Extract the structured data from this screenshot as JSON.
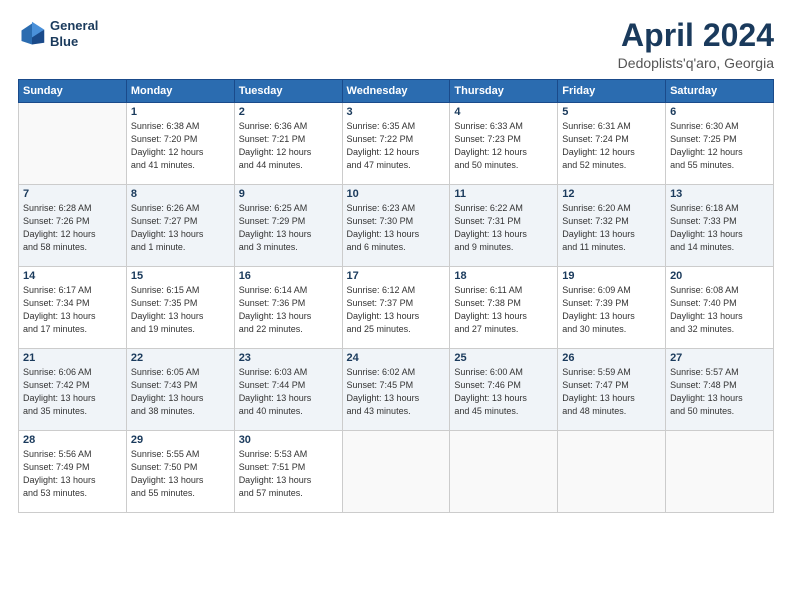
{
  "header": {
    "logo_line1": "General",
    "logo_line2": "Blue",
    "title": "April 2024",
    "location": "Dedoplists'q'aro, Georgia"
  },
  "days_of_week": [
    "Sunday",
    "Monday",
    "Tuesday",
    "Wednesday",
    "Thursday",
    "Friday",
    "Saturday"
  ],
  "weeks": [
    [
      {
        "day": "",
        "info": ""
      },
      {
        "day": "1",
        "info": "Sunrise: 6:38 AM\nSunset: 7:20 PM\nDaylight: 12 hours\nand 41 minutes."
      },
      {
        "day": "2",
        "info": "Sunrise: 6:36 AM\nSunset: 7:21 PM\nDaylight: 12 hours\nand 44 minutes."
      },
      {
        "day": "3",
        "info": "Sunrise: 6:35 AM\nSunset: 7:22 PM\nDaylight: 12 hours\nand 47 minutes."
      },
      {
        "day": "4",
        "info": "Sunrise: 6:33 AM\nSunset: 7:23 PM\nDaylight: 12 hours\nand 50 minutes."
      },
      {
        "day": "5",
        "info": "Sunrise: 6:31 AM\nSunset: 7:24 PM\nDaylight: 12 hours\nand 52 minutes."
      },
      {
        "day": "6",
        "info": "Sunrise: 6:30 AM\nSunset: 7:25 PM\nDaylight: 12 hours\nand 55 minutes."
      }
    ],
    [
      {
        "day": "7",
        "info": "Sunrise: 6:28 AM\nSunset: 7:26 PM\nDaylight: 12 hours\nand 58 minutes."
      },
      {
        "day": "8",
        "info": "Sunrise: 6:26 AM\nSunset: 7:27 PM\nDaylight: 13 hours\nand 1 minute."
      },
      {
        "day": "9",
        "info": "Sunrise: 6:25 AM\nSunset: 7:29 PM\nDaylight: 13 hours\nand 3 minutes."
      },
      {
        "day": "10",
        "info": "Sunrise: 6:23 AM\nSunset: 7:30 PM\nDaylight: 13 hours\nand 6 minutes."
      },
      {
        "day": "11",
        "info": "Sunrise: 6:22 AM\nSunset: 7:31 PM\nDaylight: 13 hours\nand 9 minutes."
      },
      {
        "day": "12",
        "info": "Sunrise: 6:20 AM\nSunset: 7:32 PM\nDaylight: 13 hours\nand 11 minutes."
      },
      {
        "day": "13",
        "info": "Sunrise: 6:18 AM\nSunset: 7:33 PM\nDaylight: 13 hours\nand 14 minutes."
      }
    ],
    [
      {
        "day": "14",
        "info": "Sunrise: 6:17 AM\nSunset: 7:34 PM\nDaylight: 13 hours\nand 17 minutes."
      },
      {
        "day": "15",
        "info": "Sunrise: 6:15 AM\nSunset: 7:35 PM\nDaylight: 13 hours\nand 19 minutes."
      },
      {
        "day": "16",
        "info": "Sunrise: 6:14 AM\nSunset: 7:36 PM\nDaylight: 13 hours\nand 22 minutes."
      },
      {
        "day": "17",
        "info": "Sunrise: 6:12 AM\nSunset: 7:37 PM\nDaylight: 13 hours\nand 25 minutes."
      },
      {
        "day": "18",
        "info": "Sunrise: 6:11 AM\nSunset: 7:38 PM\nDaylight: 13 hours\nand 27 minutes."
      },
      {
        "day": "19",
        "info": "Sunrise: 6:09 AM\nSunset: 7:39 PM\nDaylight: 13 hours\nand 30 minutes."
      },
      {
        "day": "20",
        "info": "Sunrise: 6:08 AM\nSunset: 7:40 PM\nDaylight: 13 hours\nand 32 minutes."
      }
    ],
    [
      {
        "day": "21",
        "info": "Sunrise: 6:06 AM\nSunset: 7:42 PM\nDaylight: 13 hours\nand 35 minutes."
      },
      {
        "day": "22",
        "info": "Sunrise: 6:05 AM\nSunset: 7:43 PM\nDaylight: 13 hours\nand 38 minutes."
      },
      {
        "day": "23",
        "info": "Sunrise: 6:03 AM\nSunset: 7:44 PM\nDaylight: 13 hours\nand 40 minutes."
      },
      {
        "day": "24",
        "info": "Sunrise: 6:02 AM\nSunset: 7:45 PM\nDaylight: 13 hours\nand 43 minutes."
      },
      {
        "day": "25",
        "info": "Sunrise: 6:00 AM\nSunset: 7:46 PM\nDaylight: 13 hours\nand 45 minutes."
      },
      {
        "day": "26",
        "info": "Sunrise: 5:59 AM\nSunset: 7:47 PM\nDaylight: 13 hours\nand 48 minutes."
      },
      {
        "day": "27",
        "info": "Sunrise: 5:57 AM\nSunset: 7:48 PM\nDaylight: 13 hours\nand 50 minutes."
      }
    ],
    [
      {
        "day": "28",
        "info": "Sunrise: 5:56 AM\nSunset: 7:49 PM\nDaylight: 13 hours\nand 53 minutes."
      },
      {
        "day": "29",
        "info": "Sunrise: 5:55 AM\nSunset: 7:50 PM\nDaylight: 13 hours\nand 55 minutes."
      },
      {
        "day": "30",
        "info": "Sunrise: 5:53 AM\nSunset: 7:51 PM\nDaylight: 13 hours\nand 57 minutes."
      },
      {
        "day": "",
        "info": ""
      },
      {
        "day": "",
        "info": ""
      },
      {
        "day": "",
        "info": ""
      },
      {
        "day": "",
        "info": ""
      }
    ]
  ]
}
